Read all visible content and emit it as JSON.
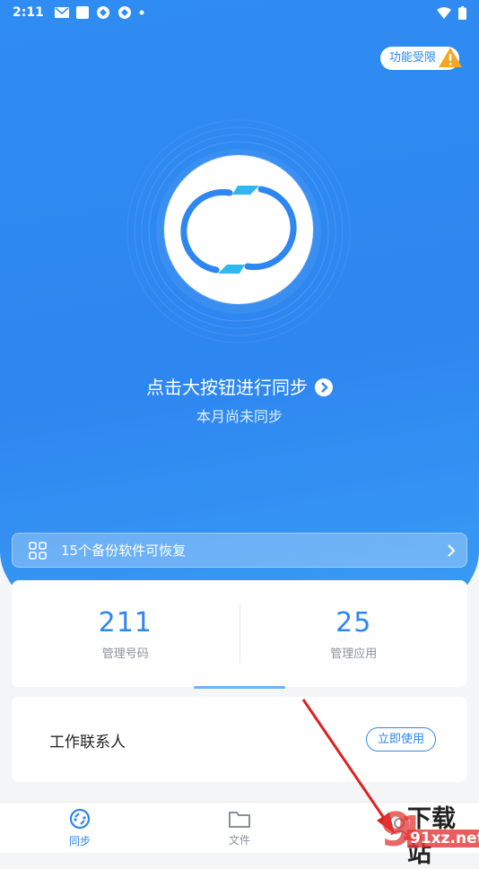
{
  "status_bar": {
    "time": "2:11"
  },
  "hero": {
    "limit_badge": "功能受限",
    "prompt": "点击大按钮进行同步",
    "subtitle": "本月尚未同步"
  },
  "restore_bar": {
    "label": "15个备份软件可恢复"
  },
  "stats": [
    {
      "value": "211",
      "label": "管理号码"
    },
    {
      "value": "25",
      "label": "管理应用"
    }
  ],
  "contacts_card": {
    "title": "工作联系人",
    "button": "立即使用"
  },
  "tabs": [
    {
      "label": "同步",
      "icon": "sync-icon",
      "active": true
    },
    {
      "label": "文件",
      "icon": "folder-icon",
      "active": false
    },
    {
      "label": "",
      "icon": "profile-icon",
      "active": false
    }
  ],
  "watermark": {
    "text1": "下载站",
    "text2": "91xz.net"
  },
  "colors": {
    "primary": "#2E86F0",
    "accent_light": "#6FB3F7",
    "warning": "#F5A623"
  }
}
